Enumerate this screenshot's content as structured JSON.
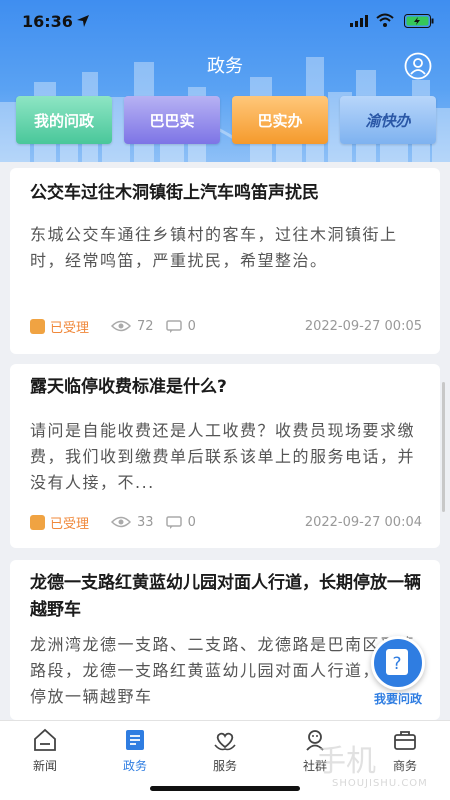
{
  "status_bar": {
    "time": "16:36"
  },
  "header": {
    "title": "政务",
    "quick_links": [
      "我的问政",
      "巴巴实",
      "巴实办",
      "渝快办"
    ]
  },
  "posts": [
    {
      "title": "公交车过往木洞镇街上汽车鸣笛声扰民",
      "body": "东城公交车通往乡镇村的客车，过往木洞镇街上时，经常鸣笛，严重扰民，希望整治。",
      "status": "已受理",
      "views": "72",
      "comments": "0",
      "date": "2022-09-27 00:05"
    },
    {
      "title": "露天临停收费标准是什么?",
      "body": "请问是自能收费还是人工收费？收费员现场要求缴费，我们收到缴费单后联系该单上的服务电话，并没有人接，不...",
      "status": "已受理",
      "views": "33",
      "comments": "0",
      "date": "2022-09-27 00:04"
    },
    {
      "title": "龙德一支路红黄蓝幼儿园对面人行道，长期停放一辆越野车",
      "body": "龙洲湾龙德一支路、二支路、龙德路是巴南区严管路段，龙德一支路红黄蓝幼儿园对面人行道，长期停放一辆越野车"
    }
  ],
  "fab": {
    "label": "我要问政"
  },
  "tabs": [
    {
      "label": "新闻",
      "icon": "home-icon"
    },
    {
      "label": "政务",
      "icon": "document-icon",
      "active": true
    },
    {
      "label": "服务",
      "icon": "heart-hands-icon"
    },
    {
      "label": "社群",
      "icon": "community-icon"
    },
    {
      "label": "商务",
      "icon": "briefcase-icon"
    }
  ],
  "watermark": {
    "text": "手机",
    "sub": "SHOUJISHU.COM"
  },
  "colors": {
    "primary": "#2f7de1",
    "status": "#f0883a",
    "header": "#4a95f1"
  }
}
